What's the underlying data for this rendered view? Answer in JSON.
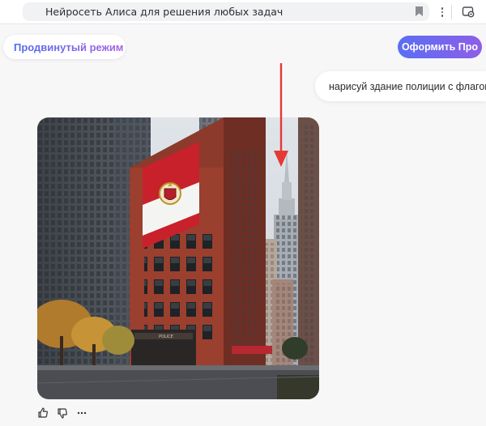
{
  "browser": {
    "tab_title": "Нейросеть Алиса для решения любых задач",
    "icons": [
      "bookmark-icon",
      "more-vertical-icon",
      "extension-icon"
    ]
  },
  "header": {
    "mode_label": "Продвинутый режим",
    "mode_icon": "chevron-down-icon",
    "pro_button": "Оформить Про"
  },
  "chat": {
    "user_message": "нарисуй здание полиции с флагом",
    "image": {
      "subject": "police building with flag",
      "flag_colors": [
        "#c8212b",
        "#f4f4f2",
        "#c8212b"
      ]
    },
    "actions": [
      "thumbs-up-icon",
      "thumbs-down-icon",
      "more-horizontal-icon"
    ]
  },
  "colors": {
    "accent_start": "#5a6ef3",
    "accent_end": "#8e5ee8",
    "annotation_arrow": "#e53935"
  }
}
